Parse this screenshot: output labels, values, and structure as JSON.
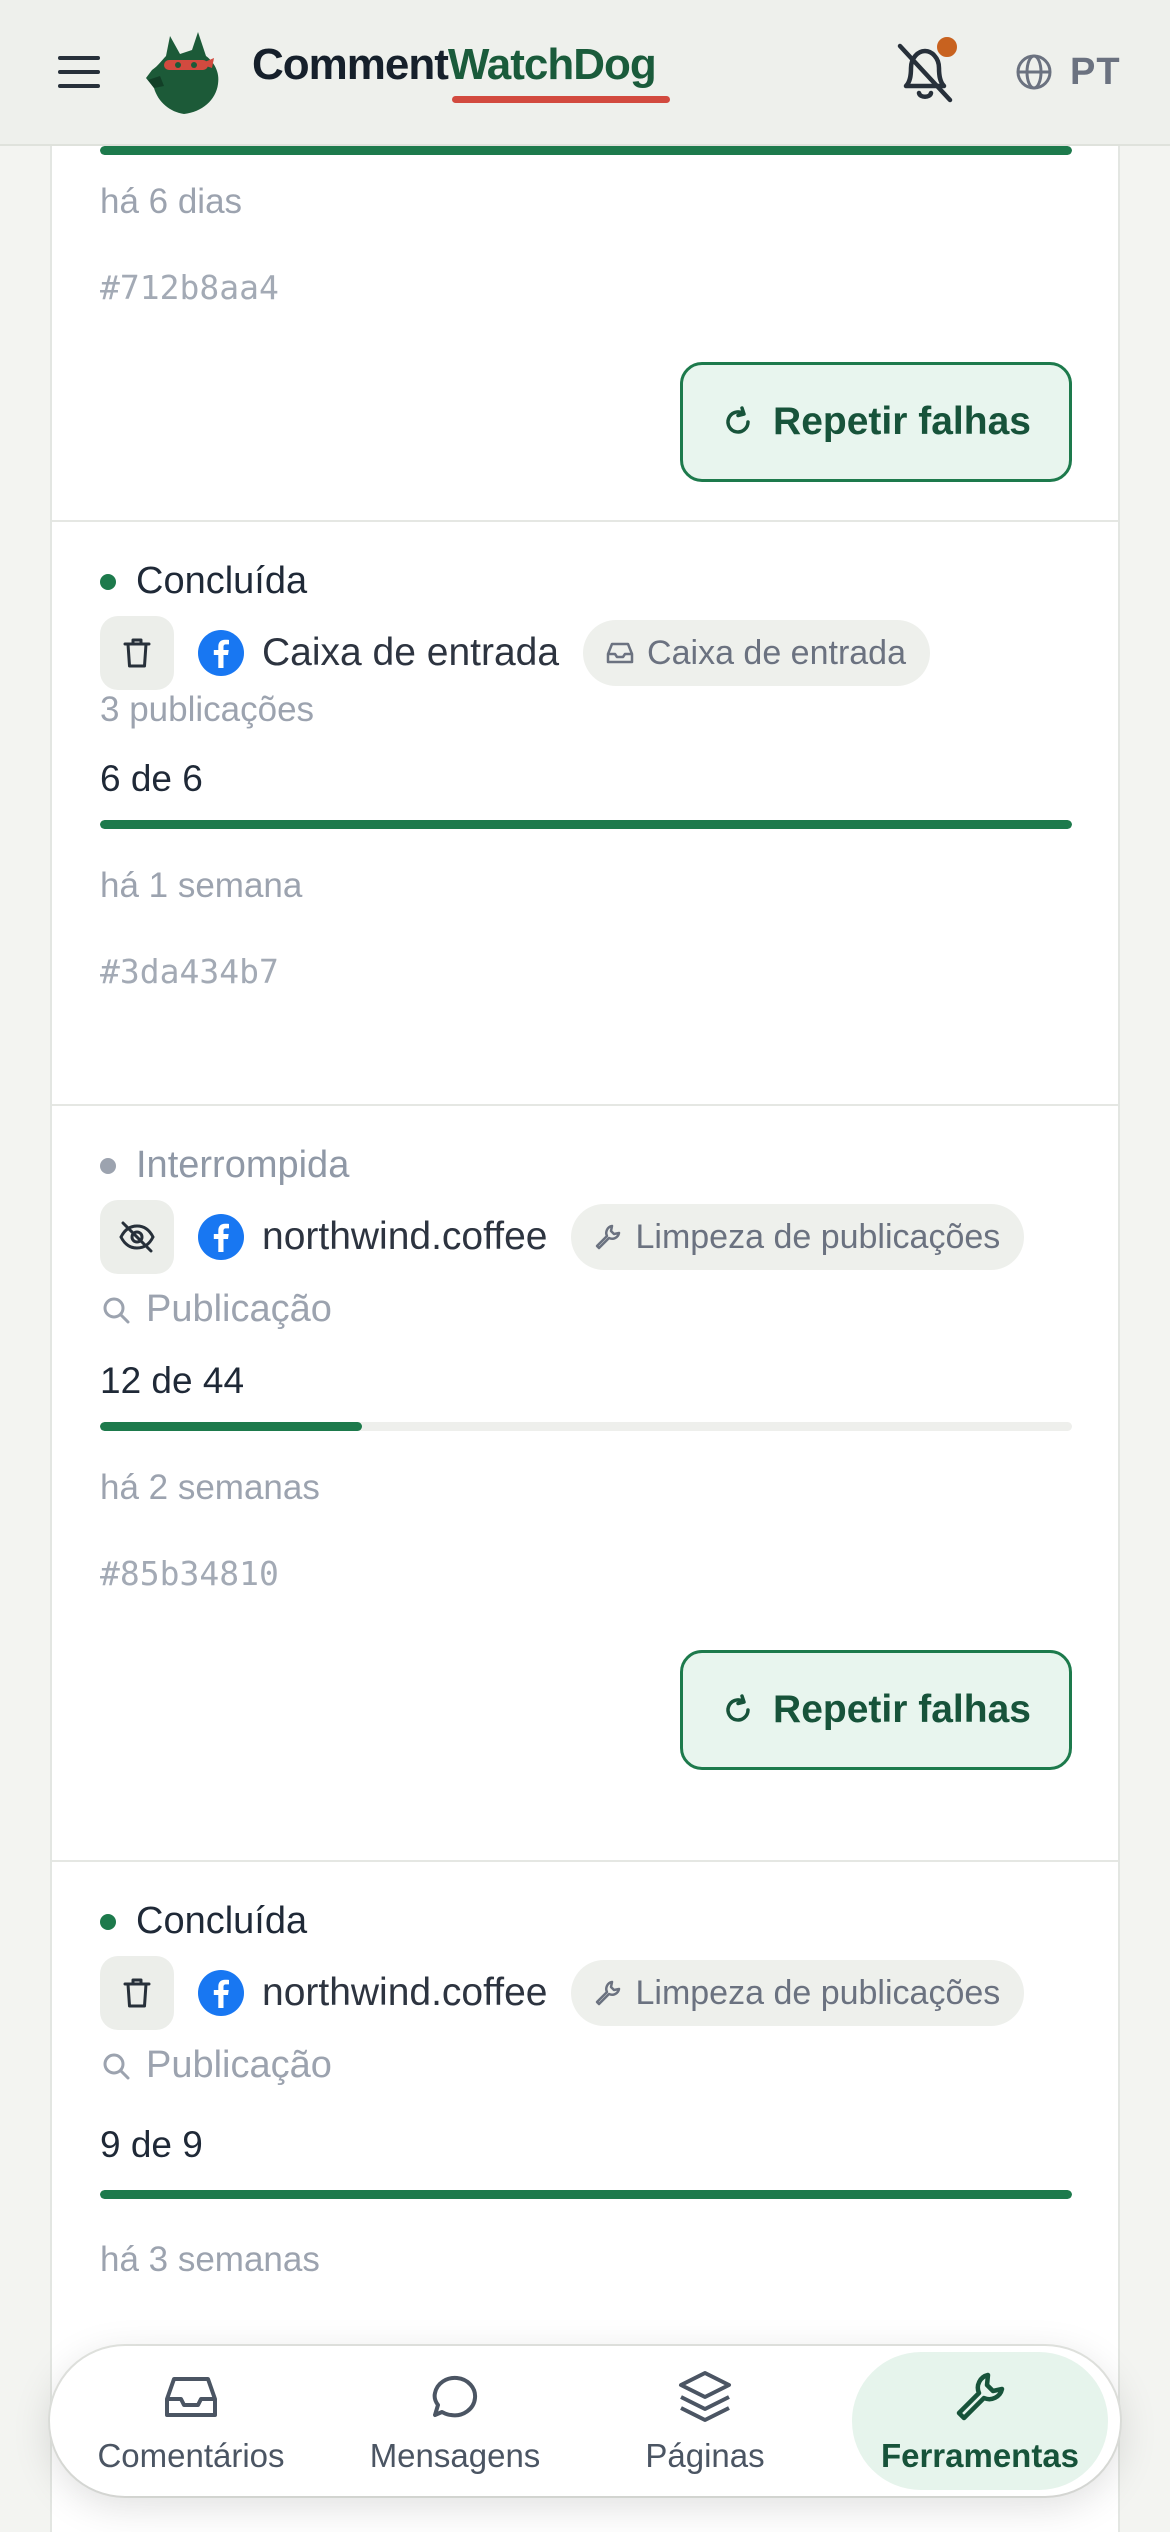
{
  "header": {
    "brand_part1": "Comment",
    "brand_part2": "WatchDog",
    "language": "PT",
    "colors": {
      "brand_dark": "#16202b",
      "brand_green": "#1a5b3b",
      "underline": "#d24a3f",
      "notification_dot": "#c8621f"
    }
  },
  "cards": [
    {
      "progress_fraction": 1.0,
      "ago": "há 6 dias",
      "hash": "#712b8aa4",
      "retry_label": "Repetir falhas"
    },
    {
      "status": "Concluída",
      "page": "Caixa de entrada",
      "chip": "Caixa de entrada",
      "sub": "3 publicações",
      "count": "6 de 6",
      "progress_fraction": 1.0,
      "ago": "há 1 semana",
      "hash": "#3da434b7"
    },
    {
      "status": "Interrompida",
      "page": "northwind.coffee",
      "chip": "Limpeza de publicações",
      "search": "Publicação",
      "count": "12 de 44",
      "progress_fraction": 0.27,
      "ago": "há 2 semanas",
      "hash": "#85b34810",
      "retry_label": "Repetir falhas"
    },
    {
      "status": "Concluída",
      "page": "northwind.coffee",
      "chip": "Limpeza de publicações",
      "search": "Publicação",
      "count": "9 de 9",
      "progress_fraction": 1.0,
      "ago": "há 3 semanas"
    }
  ],
  "nav": {
    "comments": "Comentários",
    "messages": "Mensagens",
    "pages": "Páginas",
    "tools": "Ferramentas",
    "active": "tools"
  },
  "icons": [
    "menu-icon",
    "watchdog-logo-icon",
    "bell-off-icon",
    "globe-icon",
    "retry-icon",
    "trash-icon",
    "eye-off-icon",
    "facebook-icon",
    "inbox-icon",
    "wrench-icon",
    "search-icon",
    "message-circle-icon",
    "layers-icon"
  ],
  "accent": "#1d7a4c"
}
